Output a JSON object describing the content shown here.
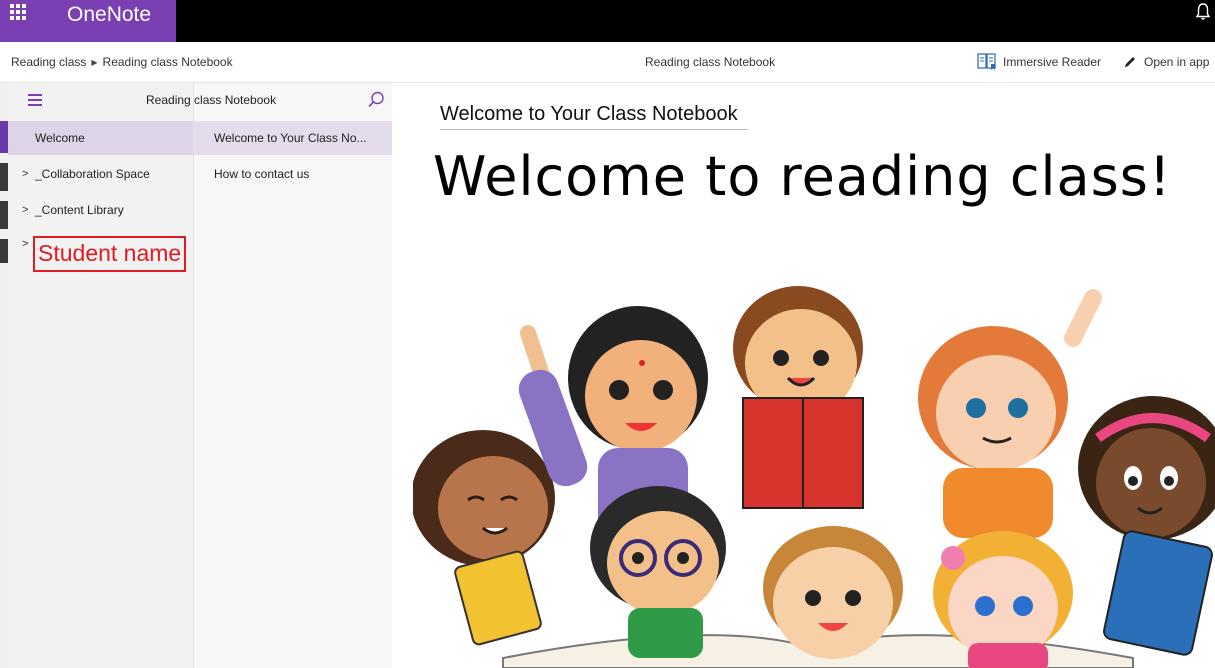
{
  "app": {
    "name": "OneNote",
    "accent": "#7a3fb3"
  },
  "command_bar": {
    "breadcrumb": [
      "Reading class",
      "Reading class Notebook"
    ],
    "center_title": "Reading class Notebook",
    "immersive_reader_label": "Immersive Reader",
    "open_in_app_label": "Open in app"
  },
  "navigation": {
    "notebook_title": "Reading class Notebook",
    "sections": [
      {
        "label": "Welcome",
        "selected": true,
        "expandable": false
      },
      {
        "label": "_Collaboration Space",
        "selected": false,
        "expandable": true
      },
      {
        "label": "_Content Library",
        "selected": false,
        "expandable": true
      }
    ],
    "student_section": {
      "label": "Student name",
      "highlight_color": "#e11b22"
    },
    "pages": [
      {
        "label": "Welcome to Your Class No...",
        "selected": true
      },
      {
        "label": "How to contact us",
        "selected": false
      }
    ]
  },
  "page": {
    "title": "Welcome to Your Class Notebook",
    "headline": "Welcome to reading class!",
    "illustration": "children-reading-books-illustration"
  }
}
